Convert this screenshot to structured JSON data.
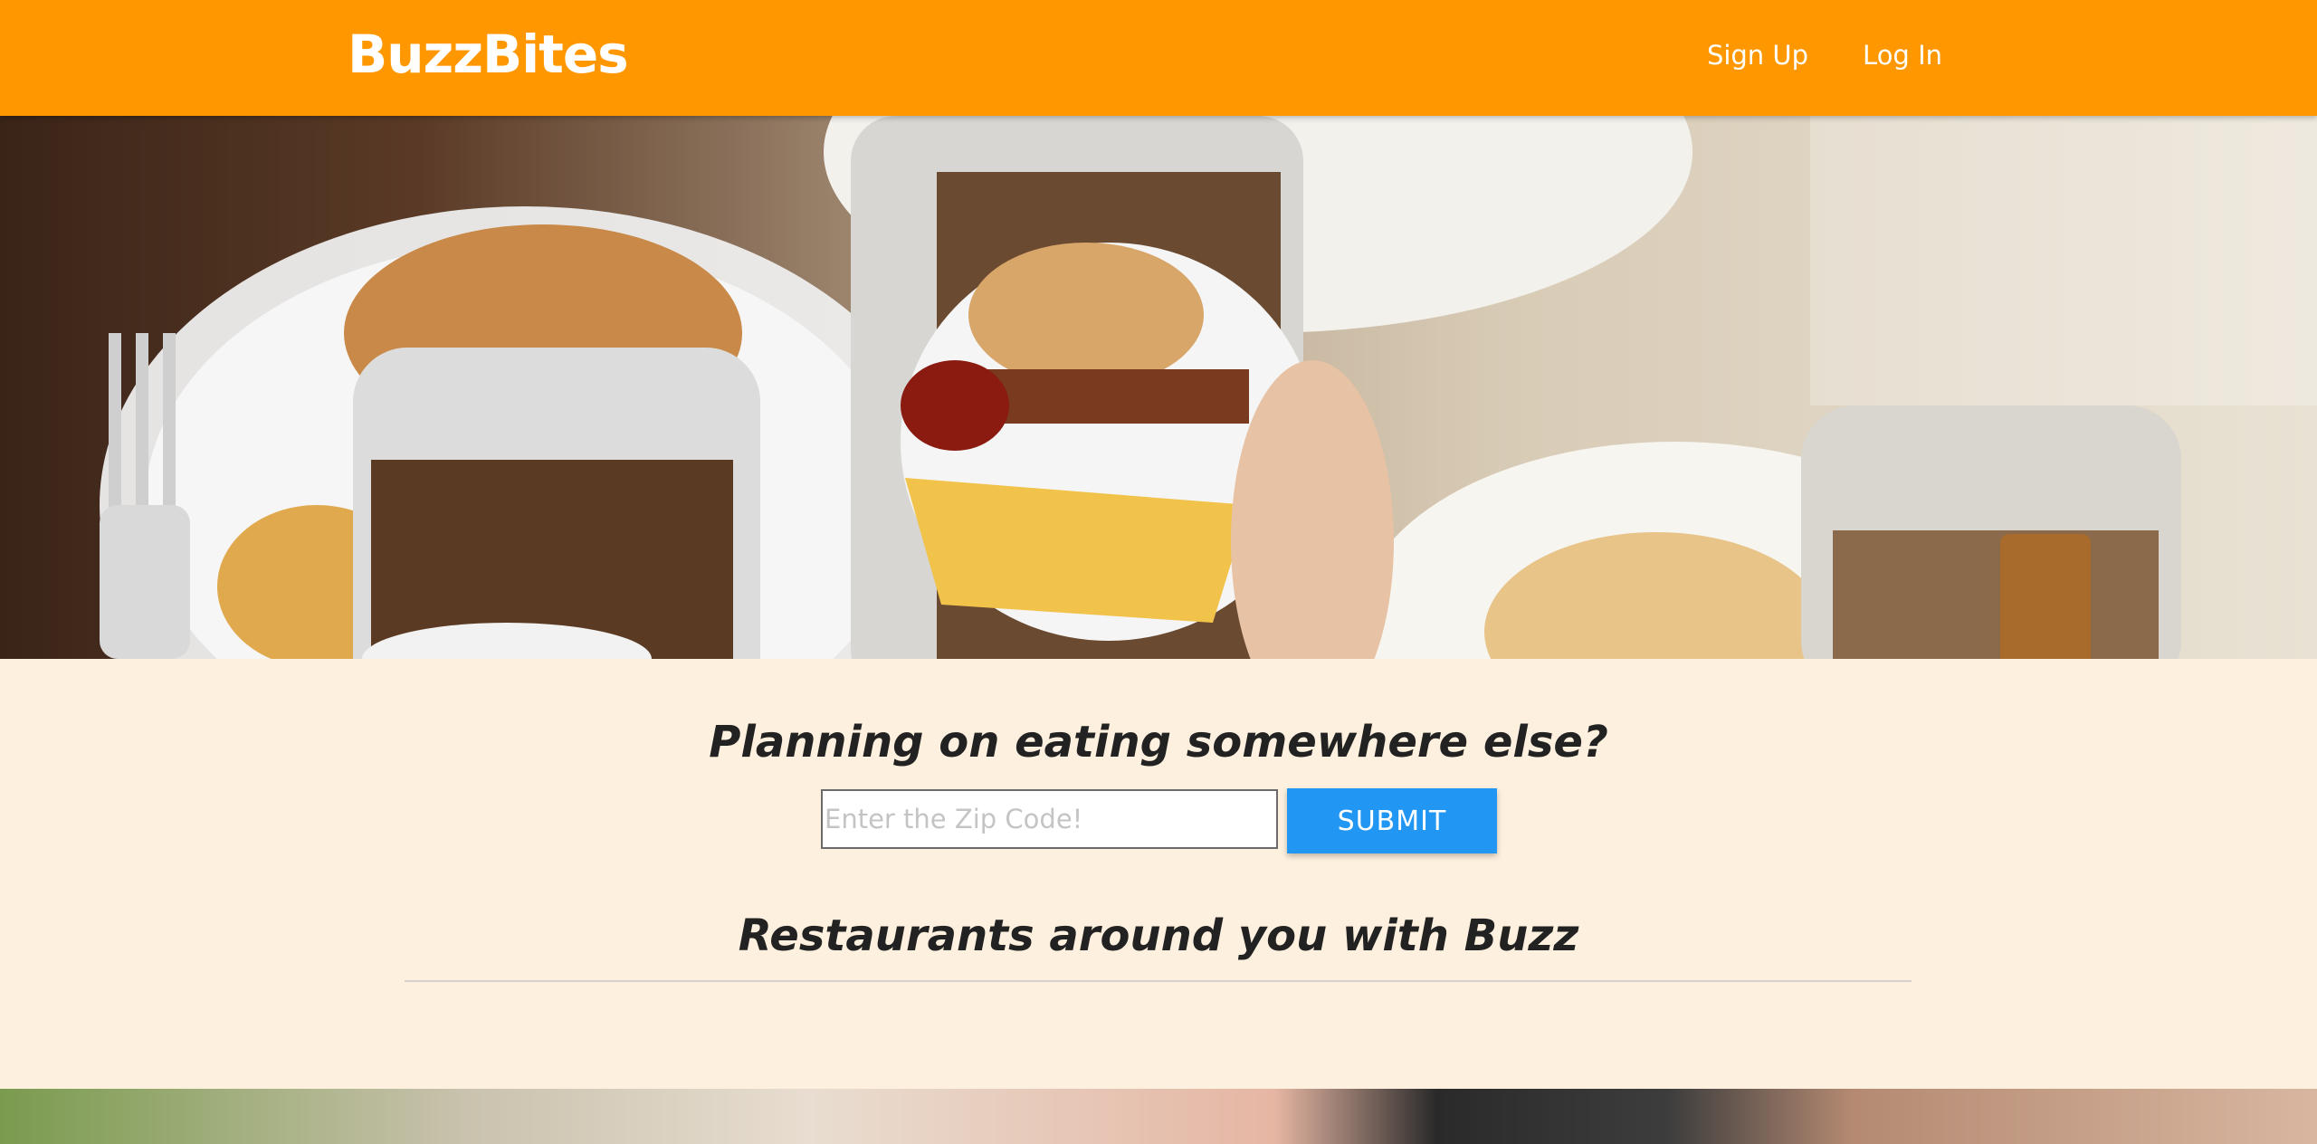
{
  "header": {
    "brand": "BuzzBites",
    "nav": [
      {
        "label": "Sign Up"
      },
      {
        "label": "Log In"
      }
    ],
    "background_color": "#ff9800"
  },
  "hero": {
    "image": "food-photo-phones-burger-fries"
  },
  "search": {
    "heading": "Planning on eating somewhere else?",
    "zip_placeholder": "Enter the Zip Code!",
    "submit_label": "SUBMIT",
    "submit_color": "#2196f3"
  },
  "restaurants": {
    "heading": "Restaurants around you with Buzz"
  },
  "footer_strip": {
    "image": "people-holding-phones-photo"
  }
}
